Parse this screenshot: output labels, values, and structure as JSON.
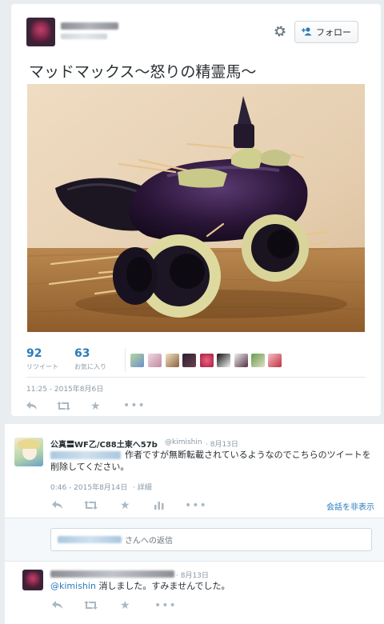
{
  "tweet": {
    "text": "マッドマックス〜怒りの精霊馬〜",
    "follow_label": "フォロー",
    "stats": {
      "retweets": "92",
      "retweets_label": "リツイート",
      "favorites": "63",
      "favorites_label": "お気に入り"
    },
    "timestamp": "11:25 - 2015年8月6日"
  },
  "reply1": {
    "name": "公真〓WF乙/C88土東へ57b",
    "handle": "@kimishin",
    "date": "· 8月13日",
    "text": "作者ですが無断転載されているようなのでこちらのツイートを削除してください。",
    "timestamp": "0:46 - 2015年8月14日",
    "detail": "· 詳細",
    "hide_conversation": "会話を非表示"
  },
  "reply_box": {
    "suffix": "さんへの返信"
  },
  "reply2": {
    "date": "· 8月13日",
    "mention": "@kimishin",
    "text": "消しました。すみませんでした。"
  },
  "colors": {
    "link": "#2b7bb9",
    "muted": "#8899a6",
    "icon": "#aab8c2"
  }
}
